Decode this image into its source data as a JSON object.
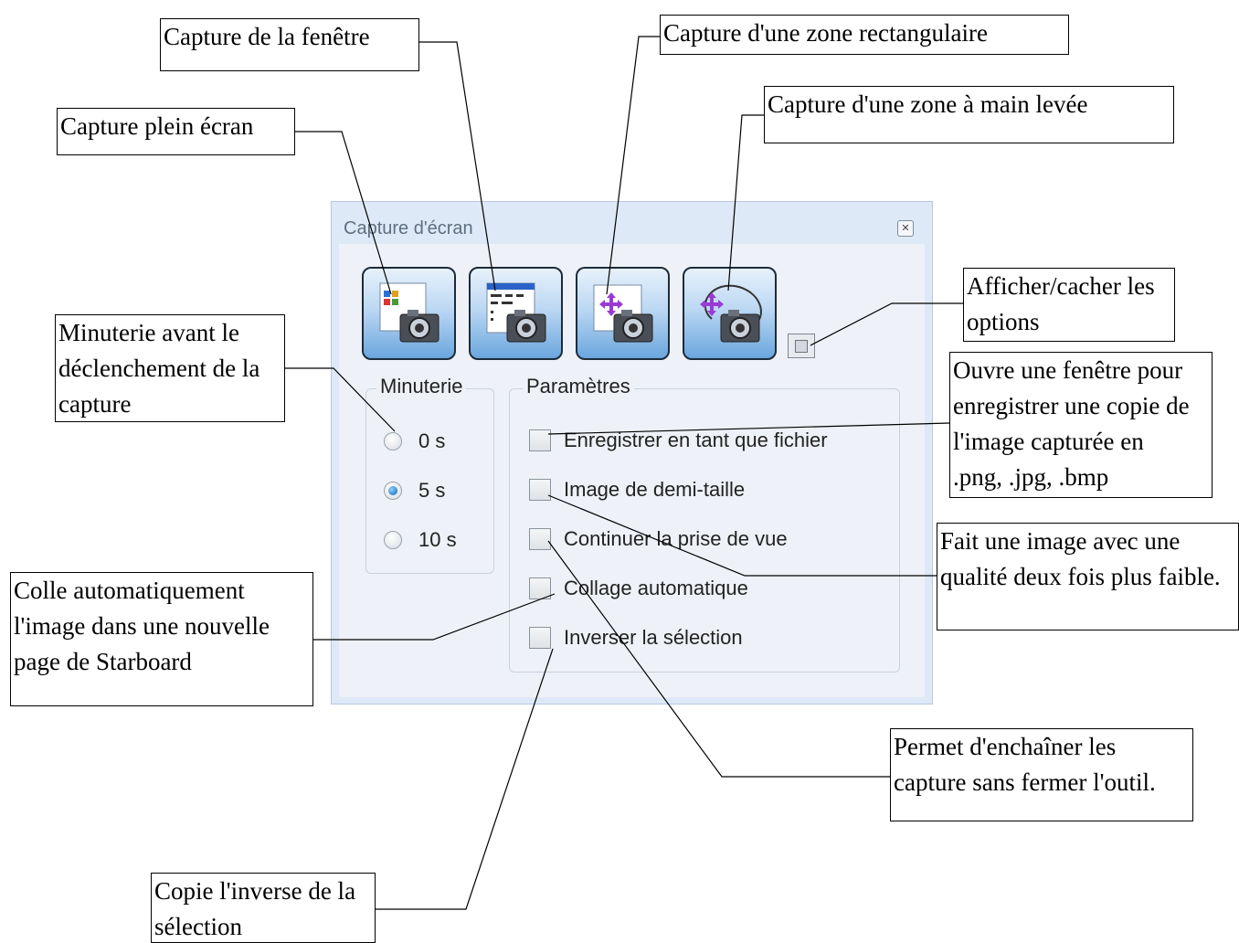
{
  "dialog": {
    "title": "Capture d'écran",
    "close_icon": "close-icon",
    "buttons": [
      {
        "name": "capture-full-screen-icon"
      },
      {
        "name": "capture-window-icon"
      },
      {
        "name": "capture-rectangle-icon"
      },
      {
        "name": "capture-freehand-icon"
      }
    ],
    "options_toggle_icon": "options-toggle-icon",
    "timer": {
      "label": "Minuterie",
      "options": [
        "0 s",
        "5 s",
        "10 s"
      ],
      "selected": "5 s"
    },
    "settings": {
      "label": "Paramètres",
      "options": [
        "Enregistrer en tant que fichier",
        "Image de demi-taille",
        "Continuer la prise de vue",
        "Collage automatique",
        "Inverser la sélection"
      ]
    }
  },
  "callouts": {
    "window": "Capture de la fenêtre",
    "rectangle": "Capture d'une zone rectangulaire",
    "freehand": "Capture d'une zone à main levée",
    "fullscreen": "Capture plein écran",
    "options": "Afficher/cacher les\noptions",
    "timer": "Minuterie avant le\ndéclenchement de la\ncapture",
    "save": "Ouvre une fenêtre pour\nenregistrer une copie de\nl'image capturée en\n.png, .jpg, .bmp",
    "half": "Fait une image avec une\nqualité deux fois plus faible.",
    "autopaste": "Colle automatiquement\nl'image dans une nouvelle\npage de Starboard",
    "continue": "Permet d'enchaîner les\ncapture sans fermer l'outil.",
    "invert": "Copie l'inverse de la\nsélection"
  }
}
